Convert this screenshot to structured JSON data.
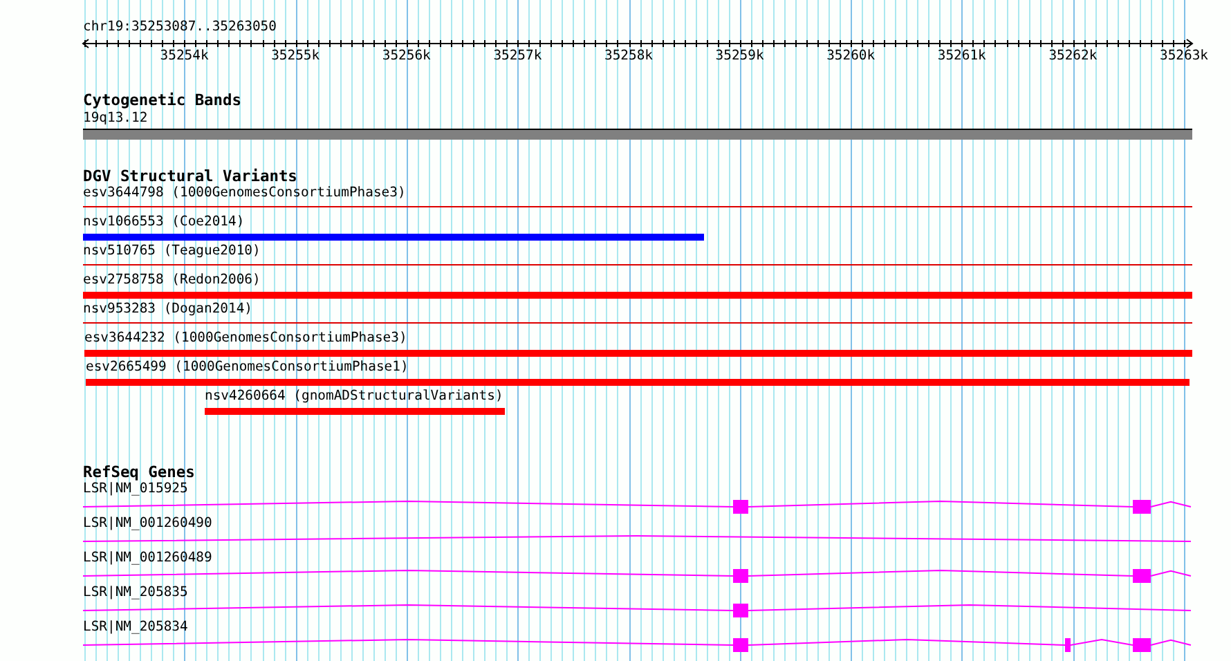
{
  "location": "chr19:35253087..35263050",
  "ruler": {
    "ticks": [
      "35254k",
      "35255k",
      "35256k",
      "35257k",
      "35258k",
      "35259k",
      "35260k",
      "35261k",
      "35262k",
      "35263k"
    ]
  },
  "tracks": [
    {
      "kind": "cytoband",
      "title": "Cytogenetic Bands",
      "features": [
        {
          "label": "19q13.12"
        }
      ]
    },
    {
      "kind": "variants",
      "title": "DGV Structural Variants",
      "features": [
        {
          "label": "esv3644798 (1000GenomesConsortiumPhase3)",
          "kind": "line",
          "color": "#dd0000"
        },
        {
          "label": "nsv1066553 (Coe2014)",
          "kind": "bar",
          "color": "#0000ff"
        },
        {
          "label": "nsv510765 (Teague2010)",
          "kind": "line",
          "color": "#dd0000"
        },
        {
          "label": "esv2758758 (Redon2006)",
          "kind": "bar",
          "color": "#ff0000"
        },
        {
          "label": "nsv953283 (Dogan2014)",
          "kind": "line",
          "color": "#dd0000"
        },
        {
          "label": "esv3644232 (1000GenomesConsortiumPhase3)",
          "kind": "bar",
          "color": "#ff0000"
        },
        {
          "label": "esv2665499 (1000GenomesConsortiumPhase1)",
          "kind": "bar",
          "color": "#ff0000"
        },
        {
          "label": "nsv4260664 (gnomADStructuralVariants)",
          "kind": "bar",
          "color": "#ff0000"
        }
      ]
    },
    {
      "kind": "genes",
      "title": "RefSeq Genes",
      "features": [
        {
          "label": "LSR|NM_015925"
        },
        {
          "label": "LSR|NM_001260490"
        },
        {
          "label": "LSR|NM_001260489"
        },
        {
          "label": "LSR|NM_205835"
        },
        {
          "label": "LSR|NM_205834"
        }
      ]
    }
  ]
}
